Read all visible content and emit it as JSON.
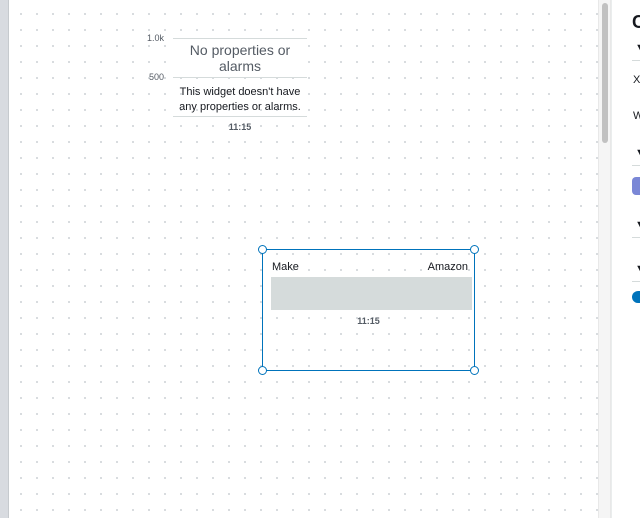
{
  "empty_widget": {
    "y_ticks": [
      "1.0k",
      "500"
    ],
    "title": "No properties or alarms",
    "description": "This widget doesn't have any properties or alarms.",
    "time": "11:15"
  },
  "selected_widget": {
    "label": "Make",
    "value": "Amazon",
    "time": "11:15"
  },
  "panel": {
    "heading": "C",
    "label_x": "X",
    "label_w": "W",
    "caret_icon": "triangle-down-icon",
    "chip_color": "#7a87d6",
    "toggle_color": "#0073bb"
  },
  "colors": {
    "selection": "#0073bb",
    "bar": "#d5dbdb"
  }
}
